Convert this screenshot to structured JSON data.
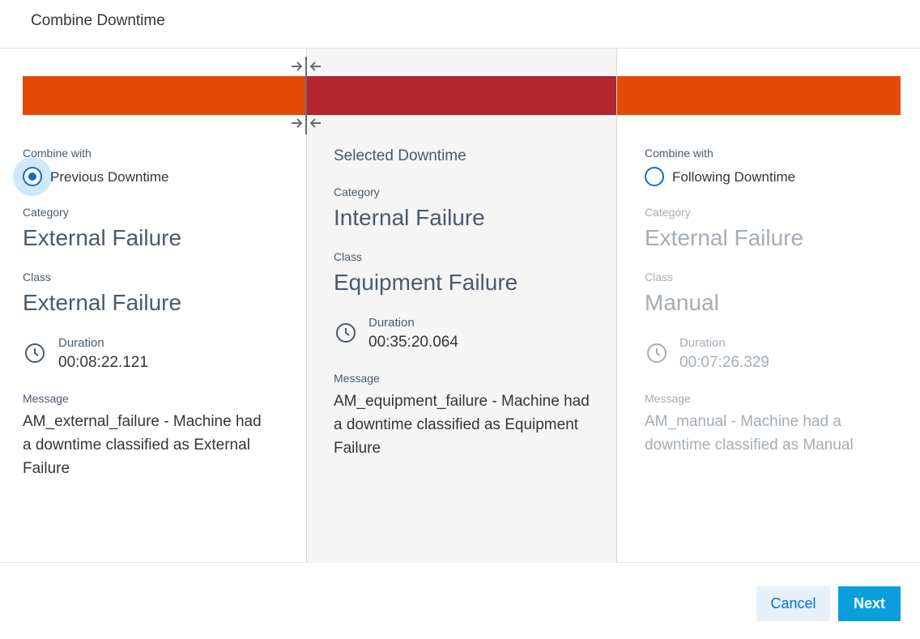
{
  "dialog": {
    "title": "Combine Downtime"
  },
  "previous": {
    "combine_label": "Combine with",
    "radio_label": "Previous Downtime",
    "selected": true,
    "category_label": "Category",
    "category": "External Failure",
    "class_label": "Class",
    "class": "External Failure",
    "duration_label": "Duration",
    "duration": "00:08:22.121",
    "message_label": "Message",
    "message": "AM_external_failure - Machine had a downtime classified as External Failure",
    "bar_color": "#e34b06"
  },
  "selected": {
    "title": "Selected Downtime",
    "category_label": "Category",
    "category": "Internal Failure",
    "class_label": "Class",
    "class": "Equipment Failure",
    "duration_label": "Duration",
    "duration": "00:35:20.064",
    "message_label": "Message",
    "message": "AM_equipment_failure - Machine had a downtime classified as Equipment Failure",
    "bar_color": "#b22632"
  },
  "following": {
    "combine_label": "Combine with",
    "radio_label": "Following Downtime",
    "selected": false,
    "category_label": "Category",
    "category": "External Failure",
    "class_label": "Class",
    "class": "Manual",
    "duration_label": "Duration",
    "duration": "00:07:26.329",
    "message_label": "Message",
    "message": "AM_manual - Machine had a downtime classified as Manual",
    "bar_color": "#e34b06"
  },
  "footer": {
    "cancel_label": "Cancel",
    "next_label": "Next"
  },
  "colors": {
    "accent": "#0a6ed1",
    "primary_button": "#0a9edc"
  },
  "icons": {
    "merge": "merge-arrows-icon",
    "clock": "clock-icon"
  }
}
